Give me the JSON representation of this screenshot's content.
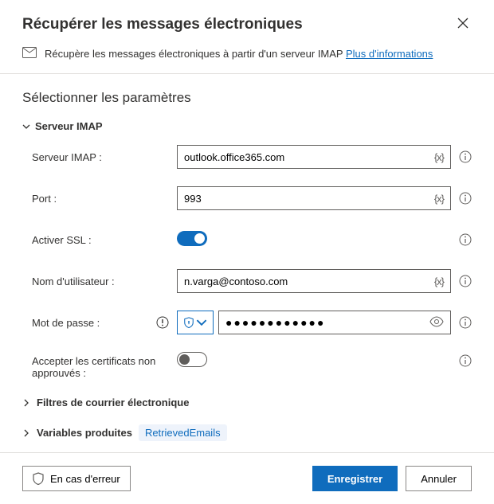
{
  "header": {
    "title": "Récupérer les messages électroniques"
  },
  "infobar": {
    "text": "Récupère les messages électroniques à partir d'un serveur IMAP ",
    "link": "Plus d'informations"
  },
  "section": {
    "title": "Sélectionner les paramètres"
  },
  "group": {
    "title": "Serveur IMAP"
  },
  "fields": {
    "server": {
      "label": "Serveur IMAP :",
      "value": "outlook.office365.com"
    },
    "port": {
      "label": "Port :",
      "value": "993"
    },
    "ssl": {
      "label": "Activer SSL :",
      "value": true
    },
    "username": {
      "label": "Nom d'utilisateur :",
      "value": "n.varga@contoso.com"
    },
    "password": {
      "label": "Mot de passe :",
      "value": "●●●●●●●●●●●●"
    },
    "accept_certs": {
      "label": "Accepter les certificats non approuvés :",
      "value": false
    }
  },
  "collapsed": {
    "filters": "Filtres de courrier électronique",
    "produced": "Variables produites",
    "produced_chip": "RetrievedEmails"
  },
  "var_token": "{x}",
  "footer": {
    "error": "En cas d'erreur",
    "save": "Enregistrer",
    "cancel": "Annuler"
  }
}
